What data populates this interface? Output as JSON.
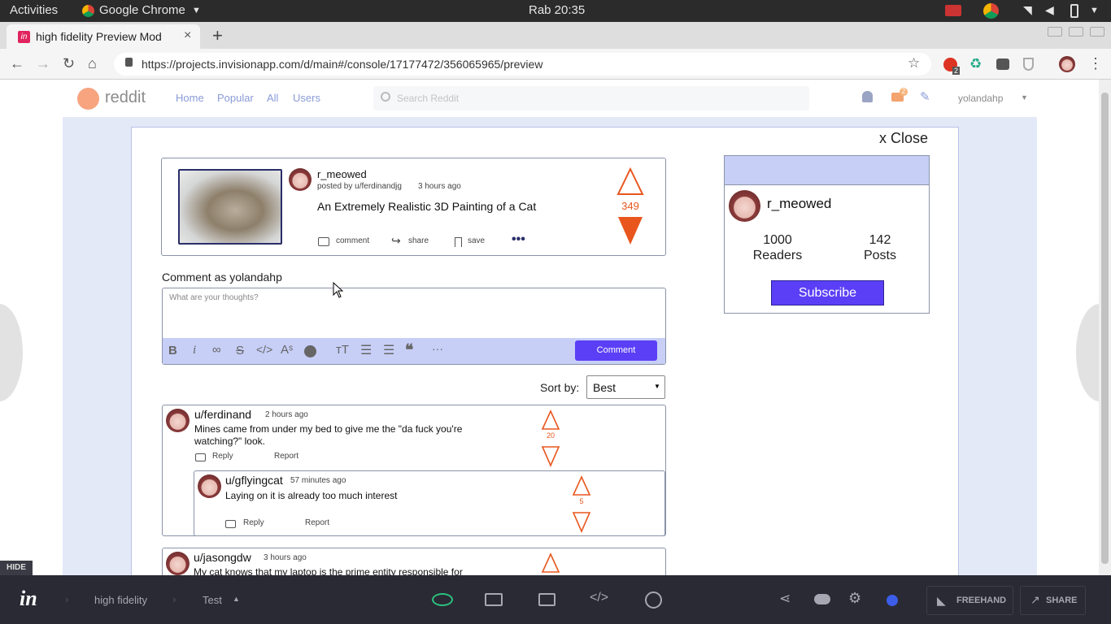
{
  "os": {
    "activities": "Activities",
    "app_name": "Google Chrome",
    "clock": "Rab 20:35"
  },
  "browser": {
    "tab_title": "high fidelity Preview Mod",
    "url": "https://projects.invisionapp.com/d/main#/console/17177472/356065965/preview",
    "ext_badge": "2"
  },
  "reddit": {
    "logo_text": "reddit",
    "nav": [
      "Home",
      "Popular",
      "All",
      "Users"
    ],
    "search_placeholder": "Search Reddit",
    "username": "yolandahp",
    "notif_badge": "2"
  },
  "modal": {
    "close_label": "x Close",
    "post": {
      "community": "r_meowed",
      "posted_by": "posted by u/ferdinandjg",
      "time": "3 hours ago",
      "title": "An Extremely Realistic 3D Painting of a Cat",
      "actions": [
        "comment",
        "share",
        "save"
      ],
      "score": "349"
    },
    "comment_as": "Comment as yolandahp",
    "comment_placeholder": "What are your thoughts?",
    "comment_button": "Comment",
    "sort_label": "Sort by:",
    "sort_value": "Best",
    "comments": [
      {
        "user": "u/ferdinand",
        "time": "2 hours ago",
        "text": "Mines came from under my bed to give me the \"da fuck you're watching?\" look.",
        "score": "20",
        "reply": "Reply",
        "report": "Report"
      },
      {
        "user": "u/gflyingcat",
        "time": "57 minutes ago",
        "text": "Laying on it is already too much interest",
        "score": "5",
        "reply": "Reply",
        "report": "Report"
      },
      {
        "user": "u/jasongdw",
        "time": "3 hours ago",
        "text": "My cat knows that my laptop is the prime entity responsible for"
      }
    ],
    "sidebar": {
      "community": "r_meowed",
      "readers_value": "1000",
      "readers_label": "Readers",
      "posts_value": "142",
      "posts_label": "Posts",
      "subscribe": "Subscribe"
    }
  },
  "invision": {
    "hide": "HIDE",
    "logo": "in",
    "breadcrumb": [
      "high fidelity",
      "Test"
    ],
    "freehand": "FREEHAND",
    "share": "SHARE"
  },
  "colors": {
    "accent": "#5b3ff6",
    "upvote": "#e8561d",
    "header_band": "#c7cff7"
  }
}
